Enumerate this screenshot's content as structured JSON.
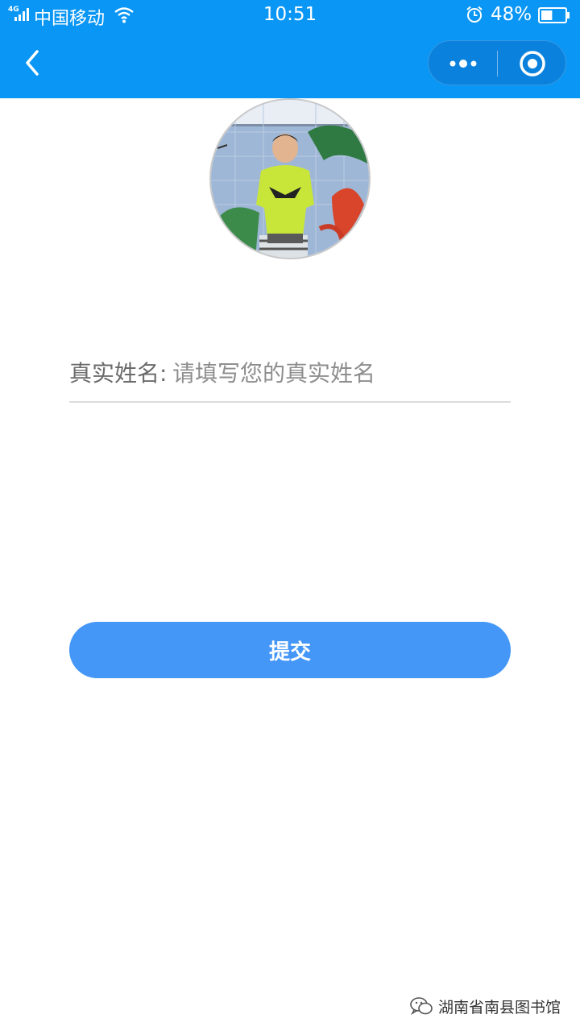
{
  "status_bar": {
    "network": "4G",
    "carrier": "中国移动",
    "time": "10:51",
    "battery": "48%",
    "battery_level": 0.48
  },
  "nav": {
    "back_icon": "chevron-left-icon",
    "more_icon": "more-dots-icon",
    "close_icon": "target-circle-icon",
    "bar_color": "#0a96f5"
  },
  "form": {
    "name_label": "真实姓名:",
    "name_placeholder": "请填写您的真实姓名",
    "name_value": "",
    "submit_label": "提交",
    "accent_color": "#4496f7"
  },
  "watermark": {
    "text": "湖南省南县图书馆",
    "icon": "wechat-icon"
  }
}
